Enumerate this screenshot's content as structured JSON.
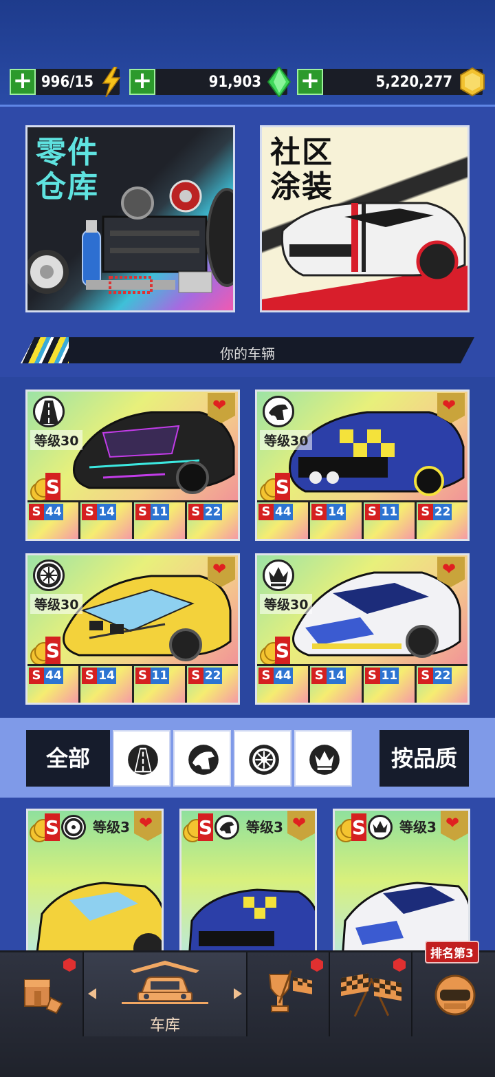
{
  "resources": {
    "energy": "996/15",
    "gems": "91,903",
    "coins": "5,220,277"
  },
  "panels": {
    "parts": "零件\n仓库",
    "parts_line1": "零件",
    "parts_line2": "仓库",
    "livery_line1": "社区",
    "livery_line2": "涂装"
  },
  "section": {
    "title": "你的车辆"
  },
  "cars": [
    {
      "class_icon": "road-icon",
      "level": "等级30",
      "parts": [
        "44",
        "14",
        "11",
        "22"
      ]
    },
    {
      "class_icon": "horse-icon",
      "level": "等级30",
      "parts": [
        "44",
        "14",
        "11",
        "22"
      ]
    },
    {
      "class_icon": "wheel-icon",
      "level": "等级30",
      "parts": [
        "44",
        "14",
        "11",
        "22"
      ]
    },
    {
      "class_icon": "crown-icon",
      "level": "等级30",
      "parts": [
        "44",
        "14",
        "11",
        "22"
      ]
    }
  ],
  "part_grade": "S",
  "filters": {
    "all": "全部",
    "quality": "按品质",
    "icons": [
      "road-icon",
      "horse-icon",
      "wheel-icon",
      "crown-icon"
    ]
  },
  "list": [
    {
      "class_icon": "wheel-icon",
      "level": "等级3"
    },
    {
      "class_icon": "horse-icon",
      "level": "等级3"
    },
    {
      "class_icon": "crown-icon",
      "level": "等级3"
    }
  ],
  "nav": {
    "garage_label": "车库",
    "rank_tag": "排名第3"
  },
  "colors": {
    "accent_green": "#2c9a2c",
    "heart": "#e02020",
    "page_blue": "#2f4aa8"
  }
}
